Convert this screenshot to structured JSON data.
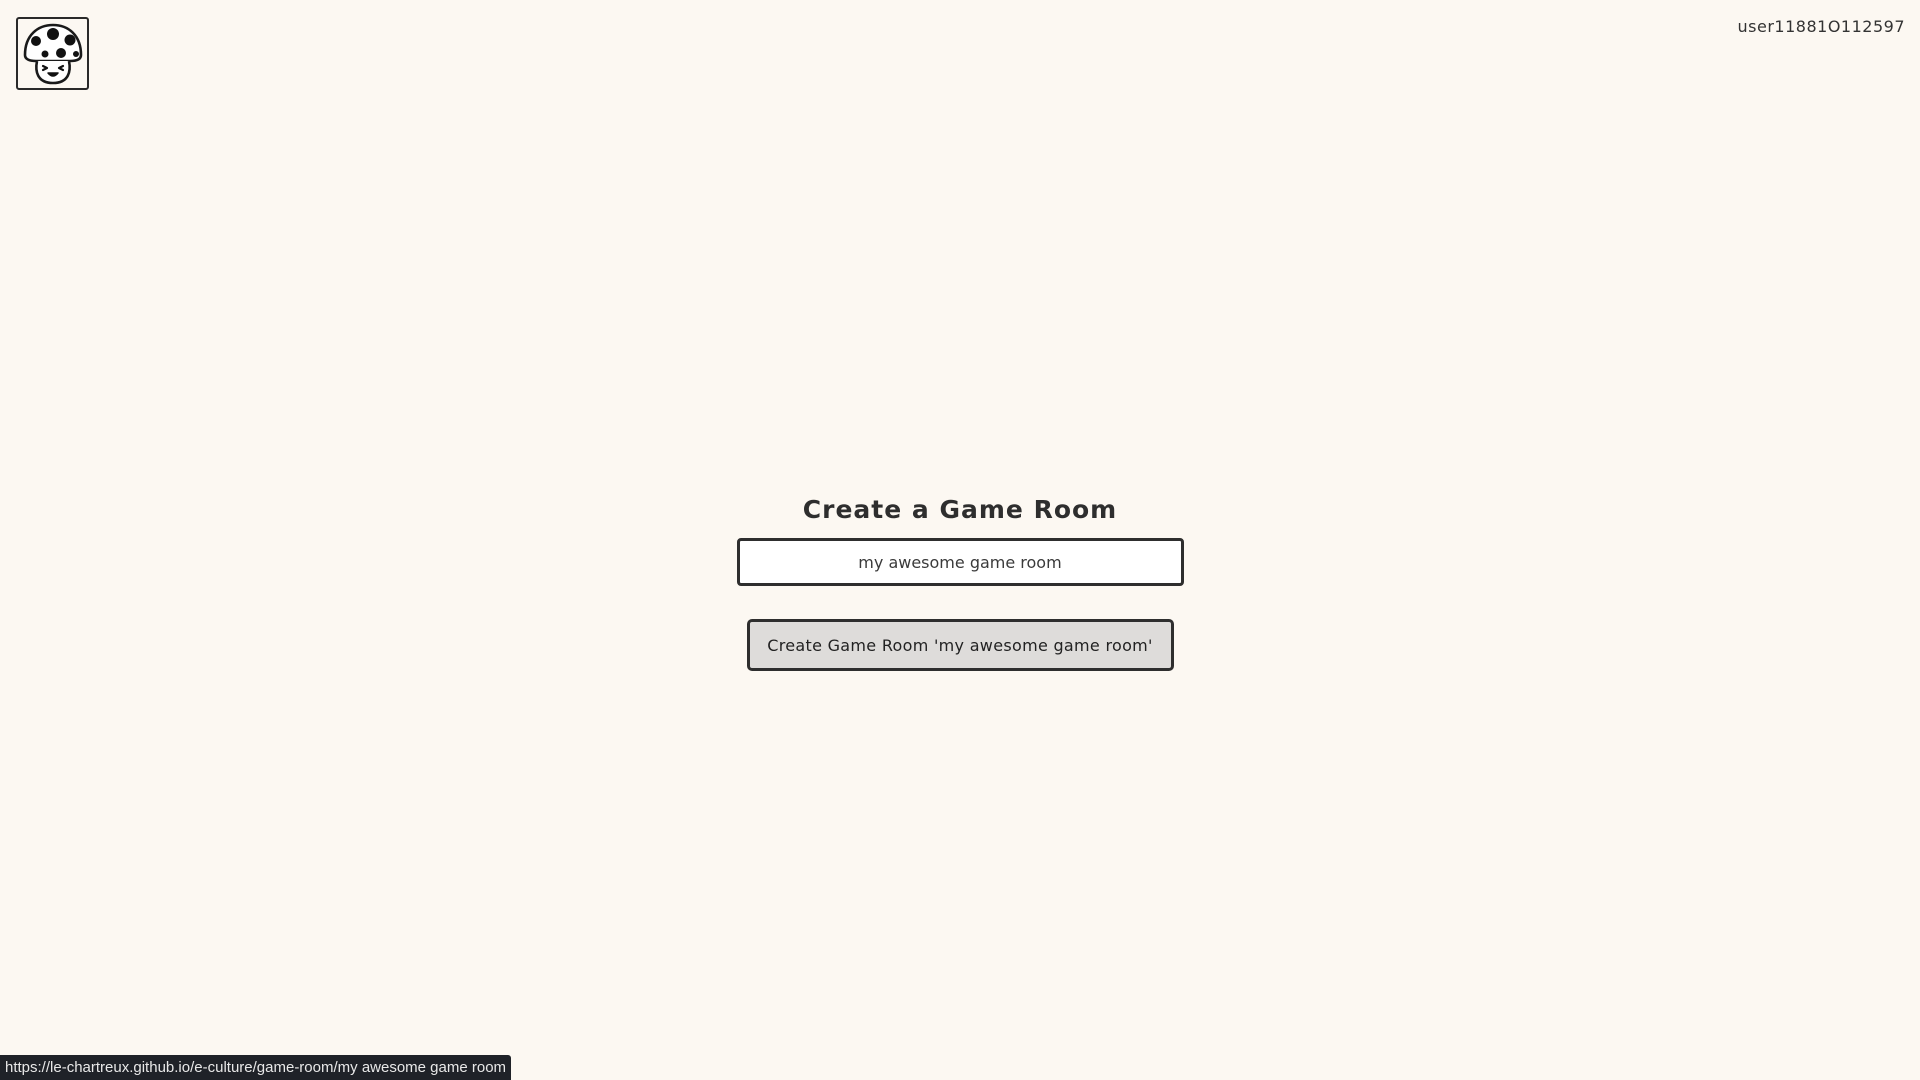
{
  "header": {
    "logo_icon": "mushroom-face-icon",
    "username": "user11881O112597"
  },
  "main": {
    "title": "Create a Game Room",
    "room_input": {
      "value": "my awesome game room",
      "placeholder": ""
    },
    "create_button_label": "Create Game Room 'my awesome game room'"
  },
  "status_bar": {
    "url": "https://le-chartreux.github.io/e-culture/game-room/my awesome game room"
  },
  "colors": {
    "background": "#fcf8f2",
    "button_background": "#dedcda",
    "border": "#2e2e2e",
    "status_bar_background": "#1f2228"
  }
}
